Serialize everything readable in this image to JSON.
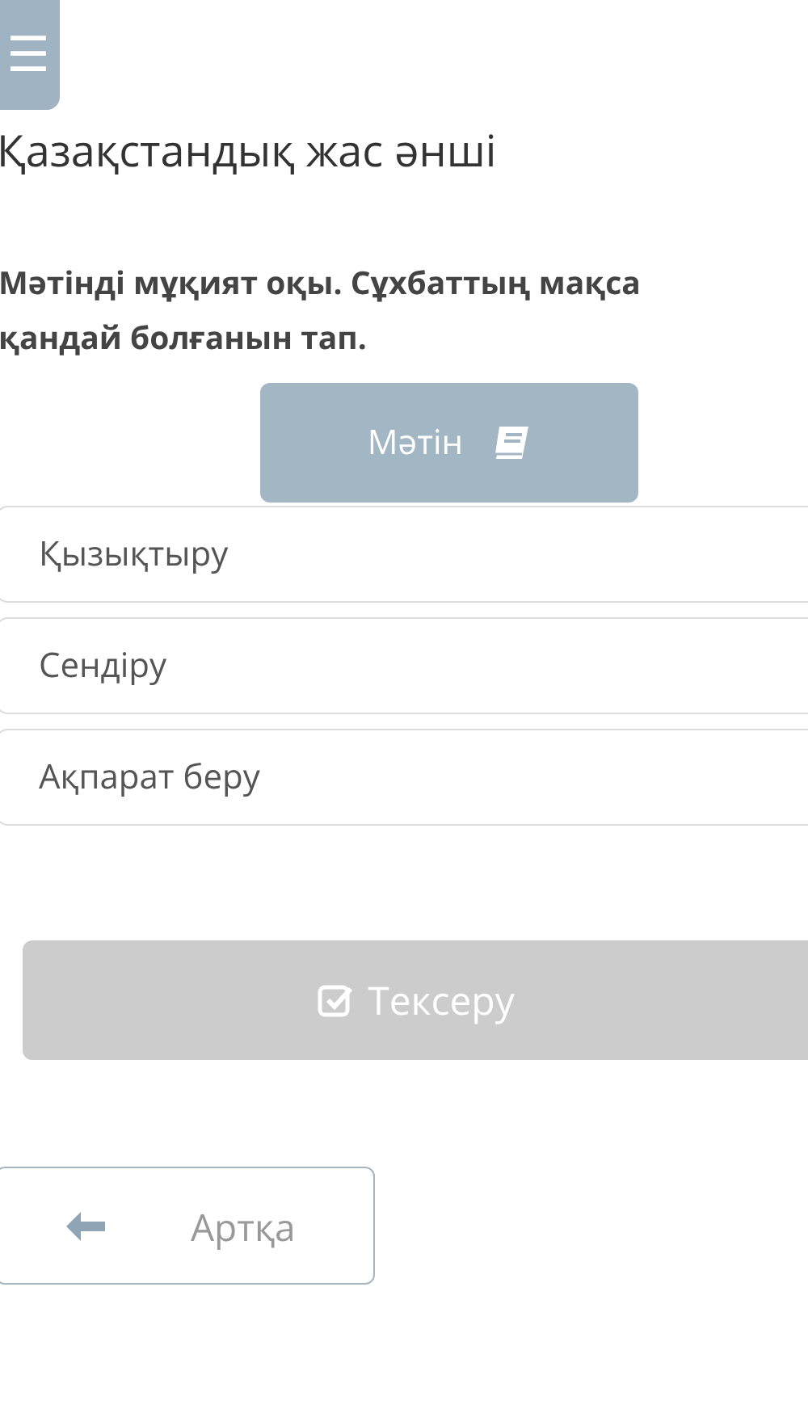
{
  "menu_button": {
    "label": "☰"
  },
  "title": "Қазақстандық жас әнші",
  "question": {
    "lines": [
      "Мәтінді мұқият оқы. Сұхбаттың мақса",
      "қандай болғанын тап."
    ]
  },
  "text_button": {
    "label": "Мәтін"
  },
  "options": [
    {
      "label": "Қызықтыру",
      "selected": false
    },
    {
      "label": "Сендіру",
      "selected": false
    },
    {
      "label": "Ақпарат беру",
      "selected": false
    }
  ],
  "check_button": {
    "label": "Тексеру",
    "disabled": true
  },
  "back_button": {
    "label": "Артқа"
  }
}
